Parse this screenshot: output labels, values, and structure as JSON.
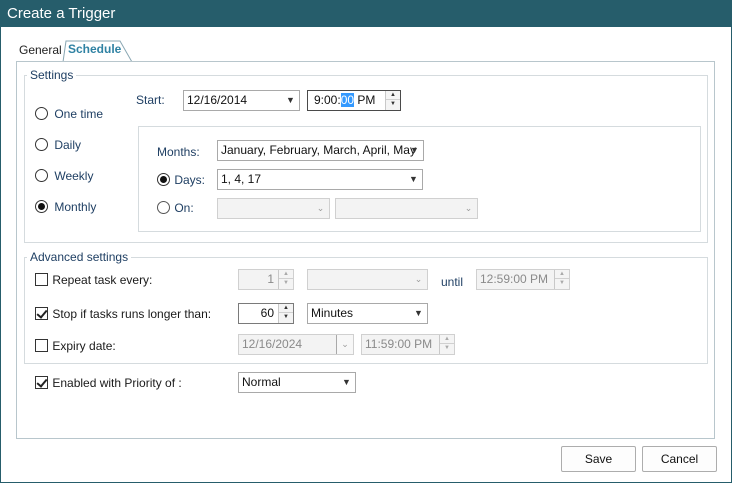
{
  "window": {
    "title": "Create a Trigger"
  },
  "tabs": {
    "general": "General",
    "schedule": "Schedule"
  },
  "settings": {
    "legend": "Settings",
    "start_label": "Start:",
    "start_date": "12/16/2014",
    "start_time_before": "9:00:",
    "start_time_selected": "00",
    "start_time_after": " PM",
    "recurrence": {
      "one_time": "One time",
      "daily": "Daily",
      "weekly": "Weekly",
      "monthly": "Monthly",
      "selected": "monthly"
    },
    "monthly": {
      "months_label": "Months:",
      "months_value": "January, February, March, April, May",
      "days_label": "Days:",
      "days_value": "1, 4, 17",
      "on_label": "On:",
      "on_value_1": "",
      "on_value_2": "",
      "selected": "days"
    }
  },
  "advanced": {
    "legend": "Advanced settings",
    "repeat_label": "Repeat task every:",
    "repeat_checked": false,
    "repeat_value": "1",
    "repeat_unit": "",
    "until_label": "until",
    "until_time": "12:59:00 PM",
    "stop_label": "Stop if tasks runs longer than:",
    "stop_checked": true,
    "stop_value": "60",
    "stop_unit": "Minutes",
    "expiry_label": "Expiry date:",
    "expiry_checked": false,
    "expiry_date": "12/16/2024",
    "expiry_time": "11:59:00 PM"
  },
  "priority": {
    "enabled_label": "Enabled with Priority of :",
    "enabled_checked": true,
    "value": "Normal"
  },
  "buttons": {
    "save": "Save",
    "cancel": "Cancel"
  },
  "colors": {
    "titlebar": "#265d6b",
    "tab_text": "#2f82a3",
    "label_blue": "#1f3f63"
  }
}
